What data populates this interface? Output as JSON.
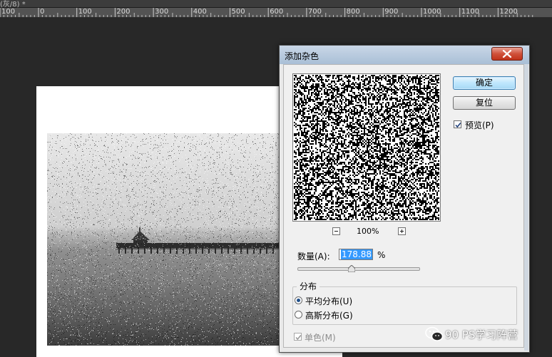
{
  "document": {
    "tab_title": "(灰/8) *",
    "ruler_labels": [
      "100",
      "0",
      "100",
      "200",
      "300",
      "400",
      "500",
      "600",
      "700",
      "800",
      "900",
      "1000",
      "1100",
      "1200"
    ]
  },
  "dialog": {
    "title": "添加杂色",
    "buttons": {
      "ok": "确定",
      "reset": "复位"
    },
    "preview": {
      "label": "预览(P)",
      "checked": true
    },
    "zoom_level": "100%",
    "amount": {
      "label": "数量(A):",
      "value": "178.88",
      "unit": "%",
      "slider_fraction": 0.45
    },
    "distribution": {
      "group_label": "分布",
      "options": [
        {
          "label": "平均分布(U)",
          "selected": true
        },
        {
          "label": "高斯分布(G)",
          "selected": false
        }
      ]
    },
    "monochromatic": {
      "label": "单色(M)",
      "checked": true,
      "disabled": true
    }
  },
  "watermark": {
    "text": "90 PS学习阵营"
  },
  "colors": {
    "workspace": "#282828",
    "ruler": "#535353",
    "dialog_title_bar": "#b7c9dd",
    "ok_button": "#bee6fd",
    "selection": "#3399ff",
    "close_button": "#c7422a"
  }
}
